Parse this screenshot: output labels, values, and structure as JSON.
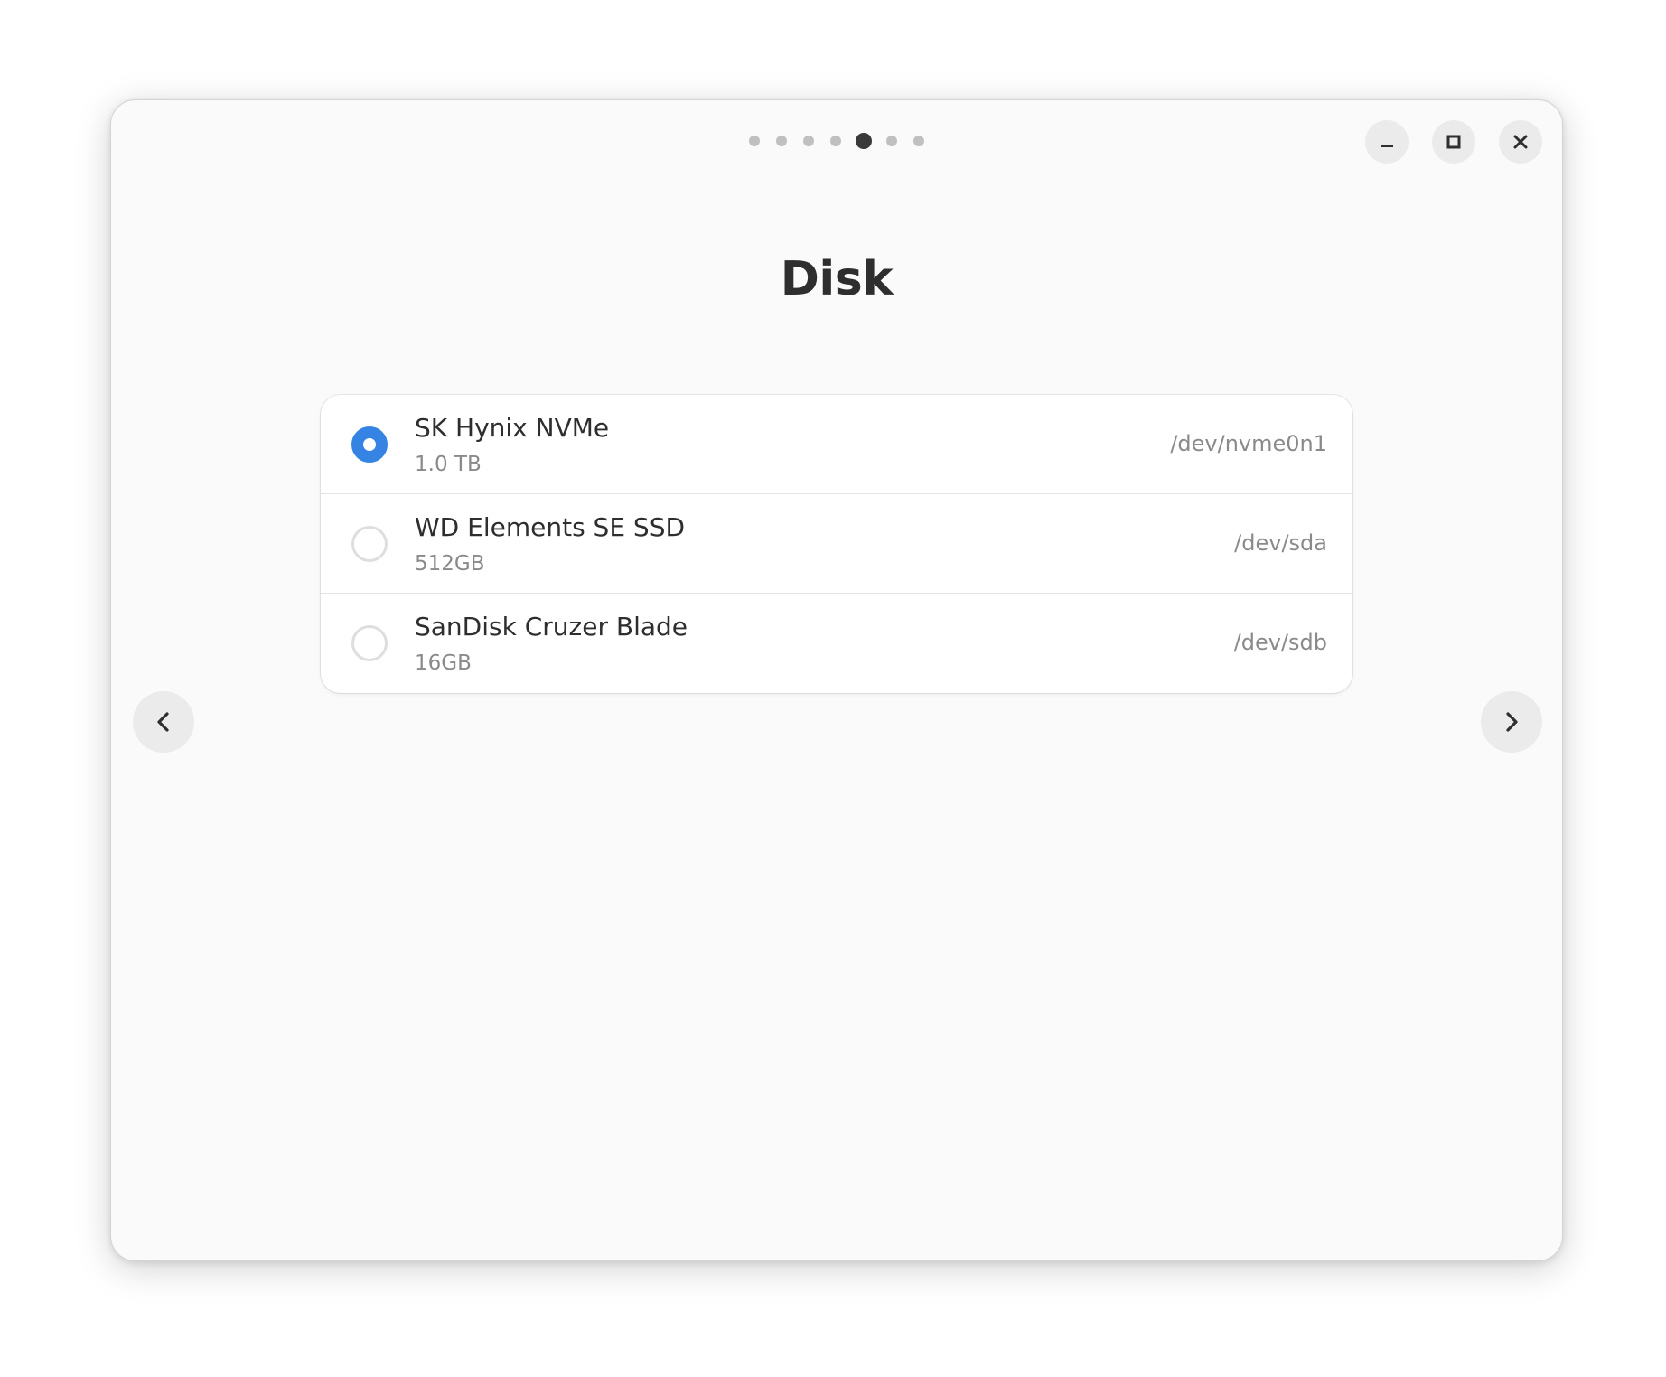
{
  "window": {
    "title": "Disk",
    "pager": {
      "count": 7,
      "active_index": 4
    },
    "controls": {
      "minimize": "minimize-icon",
      "maximize": "maximize-icon",
      "close": "close-icon"
    }
  },
  "disks": [
    {
      "name": "SK Hynix NVMe",
      "size": "1.0 TB",
      "device": "/dev/nvme0n1",
      "selected": true
    },
    {
      "name": "WD Elements SE SSD",
      "size": "512GB",
      "device": "/dev/sda",
      "selected": false
    },
    {
      "name": "SanDisk Cruzer Blade",
      "size": "16GB",
      "device": "/dev/sdb",
      "selected": false
    }
  ],
  "navigation": {
    "prev_icon": "chevron-left-icon",
    "next_icon": "chevron-right-icon"
  },
  "colors": {
    "accent": "#3584e4",
    "window_bg": "#fafafa",
    "text": "#2e2e2e",
    "muted": "#8a8a8a"
  }
}
